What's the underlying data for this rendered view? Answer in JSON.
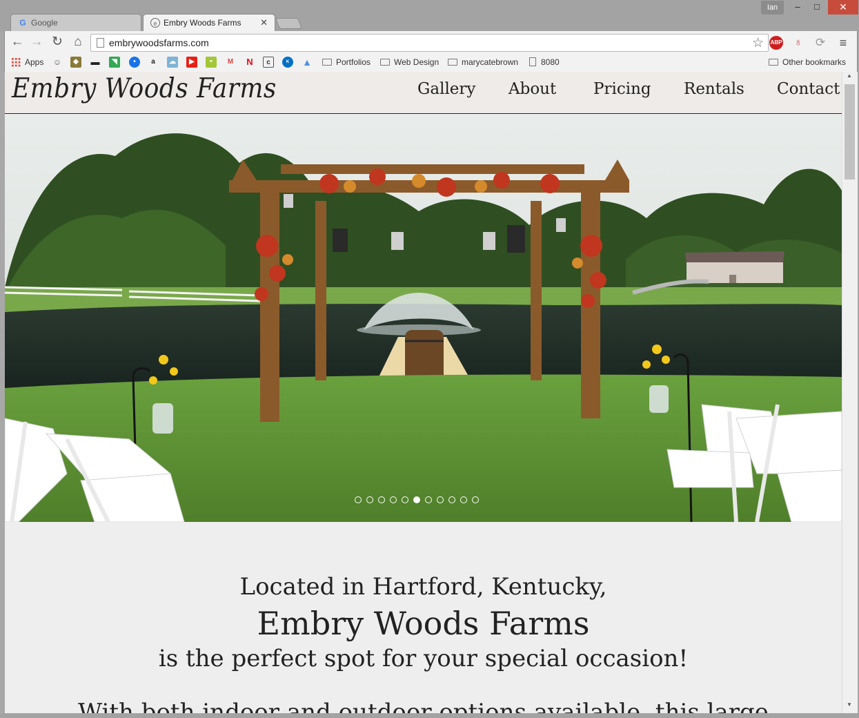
{
  "window": {
    "user": "Ian",
    "minimize_glyph": "–",
    "maximize_glyph": "□",
    "close_glyph": "✕"
  },
  "tabs": [
    {
      "title": "Google",
      "favicon": "google-g-icon",
      "active": false
    },
    {
      "title": "Embry Woods Farms",
      "favicon": "site-favicon-icon",
      "active": true
    }
  ],
  "toolbar": {
    "url": "embrywoodsfarms.com",
    "icons": [
      "back-icon",
      "forward-icon",
      "reload-icon",
      "home-icon",
      "bookmark-star-icon",
      "adblock-icon",
      "ring-icon",
      "sync-icon",
      "menu-icon"
    ]
  },
  "bookmarks": {
    "apps_label": "Apps",
    "items": [
      {
        "label": "Portfolios",
        "type": "folder"
      },
      {
        "label": "Web Design",
        "type": "folder"
      },
      {
        "label": "marycatebrown",
        "type": "folder"
      },
      {
        "label": "8080",
        "type": "page"
      }
    ],
    "other_label": "Other bookmarks"
  },
  "site": {
    "logo": "Embry Woods Farms",
    "nav": [
      "Gallery",
      "About",
      "Pricing",
      "Rentals",
      "Contact"
    ],
    "slider": {
      "slides": 11,
      "active_index": 5
    },
    "intro": {
      "line1": "Located in Hartford, Kentucky,",
      "line2": "Embry Woods Farms",
      "line3": "is the perfect spot for your special occasion!",
      "line4": "With both indoor and outdoor options available, this large"
    }
  },
  "colors": {
    "header_bg": "#eeebe8",
    "page_bg": "#eeeeee",
    "close_button": "#c74c3c",
    "grass": "#5f9a3a",
    "pond": "#1f2e2a"
  }
}
